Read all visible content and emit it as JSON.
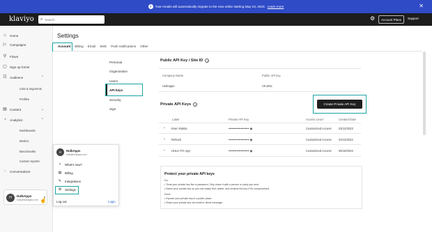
{
  "banner": {
    "info_icon": "info-icon",
    "text": "Your emails will automatically migrate to the new editor starting May 23, 2023.",
    "link": "Learn more",
    "close_icon": "close-icon"
  },
  "header": {
    "logo": "klaviyo",
    "search_placeholder": "Search",
    "account_button": "Account Plans",
    "support": "Support"
  },
  "sidebar": {
    "items": [
      {
        "label": "Home",
        "icon": "home-icon"
      },
      {
        "label": "Campaigns",
        "icon": "campaigns-icon"
      },
      {
        "label": "Flows",
        "icon": "flows-icon"
      },
      {
        "label": "Sign up forms",
        "icon": "forms-icon"
      },
      {
        "label": "Audience",
        "icon": "audience-icon"
      },
      {
        "label": "Content",
        "icon": "content-icon"
      },
      {
        "label": "Analytics",
        "icon": "analytics-icon"
      },
      {
        "label": "Conversations",
        "icon": "conversations-icon"
      }
    ],
    "audience_sub": [
      "Lists & segments",
      "Profiles"
    ],
    "analytics_sub": [
      "Dashboards",
      "Metrics",
      "Benchmarks",
      "Custom reports"
    ],
    "user": {
      "initial": "H",
      "name": "HulkApps",
      "email": "hulk@hulkapps.com"
    }
  },
  "popup": {
    "initial": "H",
    "name": "HulkApps",
    "email": "hulk@hulkapps.com",
    "items": [
      "What's new?",
      "Billing",
      "Integrations",
      "Settings"
    ],
    "logout": "Log out",
    "login": "Login"
  },
  "page": {
    "title": "Settings",
    "tabs": [
      "Account",
      "Billing",
      "Email",
      "SMS",
      "Push notifications",
      "Other"
    ]
  },
  "subnav": [
    "Personal",
    "Organization",
    "Users",
    "API keys",
    "Security",
    "Sign"
  ],
  "public_api": {
    "title": "Public API Key / Site ID",
    "col_company": "Company Name",
    "col_key": "Public API key",
    "company": "Hulkapps",
    "key": "VKJX6c"
  },
  "private_api": {
    "title": "Private API Keys",
    "create_button": "Create Private API Key",
    "columns": [
      "Label",
      "Private API Key",
      "Access Level",
      "Created Date"
    ],
    "rows": [
      {
        "label": "Esen Rakita",
        "key": "••••••••••••••••••••",
        "access": "Customized Access",
        "date": "03/12/2022"
      },
      {
        "label": "Refiock",
        "key": "••••••••••••••••••••",
        "access": "Customized Access",
        "date": "04/11/2023"
      },
      {
        "label": "HULK PO App",
        "key": "••••••••••••••••••••",
        "access": "Customized Access",
        "date": "05/16/2022"
      }
    ]
  },
  "protect": {
    "title": "Protect your private API keys",
    "do_label": "Do:",
    "do_items": [
      "Treat your private key like a password. Only share it with a person or party you trust.",
      "Name your private key so you can easily find, delete, and rename the key if it's compromised."
    ],
    "dont_label": "Don't:",
    "dont_items": [
      "Expose your private key in a public place.",
      "Share your private key via email or direct message."
    ]
  }
}
